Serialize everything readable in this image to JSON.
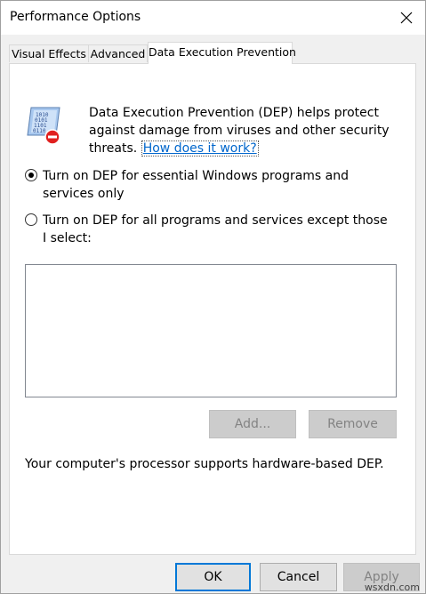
{
  "window": {
    "title": "Performance Options"
  },
  "tabs": [
    {
      "label": "Visual Effects"
    },
    {
      "label": "Advanced"
    },
    {
      "label": "Data Execution Prevention"
    }
  ],
  "dep": {
    "intro_text": "Data Execution Prevention (DEP) helps protect against damage from viruses and other security threats.",
    "help_link": "How does it work?",
    "options": [
      {
        "label": "Turn on DEP for essential Windows programs and services only",
        "checked": true
      },
      {
        "label": "Turn on DEP for all programs and services except those I select:",
        "checked": false
      }
    ],
    "add_button": "Add...",
    "remove_button": "Remove",
    "status_text": "Your computer's processor supports hardware-based DEP."
  },
  "footer": {
    "ok": "OK",
    "cancel": "Cancel",
    "apply": "Apply"
  },
  "watermark": "wsxdn.com",
  "colors": {
    "accent": "#0078d7",
    "link": "#0066cc"
  },
  "icons": {
    "close": "close-icon",
    "dep": "dep-shield-icon"
  }
}
